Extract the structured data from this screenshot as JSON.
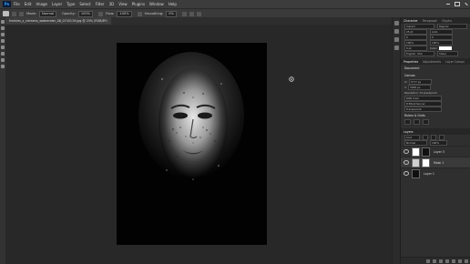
{
  "menu": {
    "app_icon": "Ps",
    "items": [
      "File",
      "Edit",
      "Image",
      "Layer",
      "Type",
      "Select",
      "Filter",
      "3D",
      "View",
      "Plugins",
      "Window",
      "Help"
    ]
  },
  "options": {
    "mode_label": "Mode:",
    "mode_value": "Normal",
    "opacity_label": "Opacity:",
    "opacity_value": "100%",
    "flow_label": "Flow:",
    "flow_value": "100%",
    "smoothing_label": "Smoothing:",
    "smoothing_value": "0%"
  },
  "document": {
    "tab_title": "freckles_s_clemens_webrender_06_0743119.jpg @ 25% (RGB/8*)"
  },
  "panels": {
    "character_tabs": [
      "Character",
      "Paragraph",
      "Glyphs"
    ],
    "font_family": "Impact",
    "font_style": "Regular",
    "font_size": "25 pt",
    "leading": "Auto",
    "tracking": "0",
    "scale_v": "100%",
    "scale_h": "100%",
    "baseline": "0 pt",
    "color_label": "Color:",
    "language": "English: USA",
    "aa": "Sharp",
    "properties_tabs": [
      "Properties",
      "Adjustments",
      "Layer Comps"
    ],
    "doc_label": "Document",
    "canvas_section": "Canvas",
    "width": "3777 px",
    "height": "5000 px",
    "resolution": "Resolution: 72 pixels/inch",
    "mode_select": "RGB Color",
    "bit_depth": "8 Bits/Channel",
    "fill": "Transparent",
    "rulers_section": "Rulers & Grids",
    "layers_title": "Layers",
    "kind_label": "Kind",
    "blend": "Normal",
    "opacity": "100%",
    "layers": [
      {
        "name": "Layer 3",
        "thumb": "#ffffff"
      },
      {
        "name": "Mask 1",
        "thumb": "#cfcfcf"
      },
      {
        "name": "Layer 1",
        "thumb": "#101010"
      }
    ]
  },
  "colors": {
    "accent": "#30a8ff",
    "panel_bg": "#2f2f2f",
    "canvas_bg": "#282828"
  }
}
